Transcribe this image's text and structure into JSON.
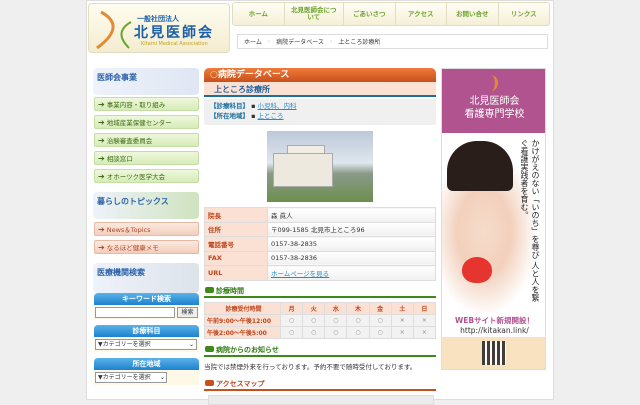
{
  "logo": {
    "line1": "一般社団法人",
    "line2": "北見医師会",
    "line3": "Kitami Medical Association"
  },
  "nav": [
    "ホーム",
    "北見医師会について",
    "ごあいさつ",
    "アクセス",
    "お問い合せ",
    "リンクス"
  ],
  "breadcrumb": [
    "ホーム",
    "病院データベース",
    "上ところ診療所"
  ],
  "sidebar": {
    "jigyo_title": "医師会事業",
    "jigyo_items": [
      "事業内容・取り組み",
      "地域産業保健センター",
      "治験審査委員会",
      "相談窓口",
      "オホーツク医学大会"
    ],
    "topics_title": "暮らしのトピックス",
    "topics_items": [
      "News＆Topics",
      "なるほど健康メモ"
    ],
    "search_title": "医療機関検索",
    "keyword_label": "キーワード検索",
    "search_button": "検索",
    "dept_label": "診療科目",
    "dept_select": "▼カテゴリーを選択",
    "area_label": "所在地域",
    "area_select": "▼カテゴリーを選択"
  },
  "main": {
    "title": "病院データベース",
    "clinic_name": "上ところ診療所",
    "dept_key": "【診療科目】",
    "dept_values": "小児科、内科",
    "area_key": "【所在地域】",
    "area_value": "上ところ",
    "details": [
      {
        "k": "院長",
        "v": "森 眞人"
      },
      {
        "k": "住所",
        "v": "〒099-1585 北見市上ところ96"
      },
      {
        "k": "電話番号",
        "v": "0157-38-2835"
      },
      {
        "k": "FAX",
        "v": "0157-38-2836"
      },
      {
        "k": "URL",
        "v": "ホームページを見る"
      }
    ],
    "hours_title": "診療時間",
    "hours_header": [
      "診療受付時間",
      "月",
      "火",
      "水",
      "木",
      "金",
      "土",
      "日"
    ],
    "hours_rows": [
      [
        "午前9:00〜午後12:00",
        "○",
        "○",
        "○",
        "○",
        "○",
        "×",
        "×"
      ],
      [
        "午後2:00〜午後5:00",
        "○",
        "○",
        "○",
        "○",
        "○",
        "×",
        "×"
      ]
    ],
    "notice_title": "病院からのお知らせ",
    "notice_text": "当院では禁煙外来を行っております。予約不要で随時受付しております。",
    "access_title": "アクセスマップ"
  },
  "banner": {
    "title1": "北見医師会",
    "title2": "看護専門学校",
    "catch": "かけがえのない「いのち」を尊び 人と人を繋ぐ看護実践者を育む。",
    "web": "WEBサイト新規開設！",
    "url": "http://kitakan.link/"
  },
  "colors": {
    "orange": "#d85a22",
    "green": "#3d8a16",
    "blue": "#1f82cc",
    "banner": "#b0538f"
  }
}
